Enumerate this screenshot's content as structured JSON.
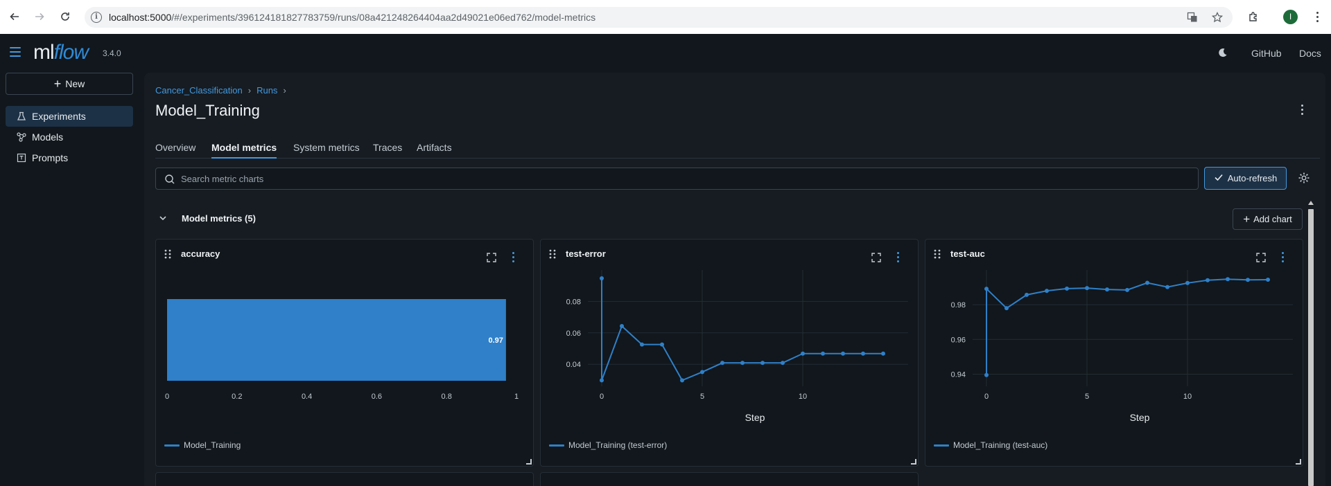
{
  "browser": {
    "url_host": "localhost:5000",
    "url_path": "/#/experiments/396124181827783759/runs/08a421248264404aa2d49021e06ed762/model-metrics",
    "profile_initial": "I"
  },
  "header": {
    "logo_ml": "ml",
    "logo_flow": "flow",
    "version": "3.4.0",
    "links": [
      "GitHub",
      "Docs"
    ]
  },
  "sidebar": {
    "new_label": "New",
    "items": [
      {
        "label": "Experiments",
        "icon": "beaker-icon",
        "active": true
      },
      {
        "label": "Models",
        "icon": "models-icon",
        "active": false
      },
      {
        "label": "Prompts",
        "icon": "prompt-icon",
        "active": false
      }
    ]
  },
  "breadcrumb": [
    "Cancer_Classification",
    "Runs"
  ],
  "page_title": "Model_Training",
  "tabs": [
    "Overview",
    "Model metrics",
    "System metrics",
    "Traces",
    "Artifacts"
  ],
  "active_tab": "Model metrics",
  "search": {
    "placeholder": "Search metric charts",
    "value": ""
  },
  "auto_refresh_label": "Auto-refresh",
  "section": {
    "title": "Model metrics (5)",
    "add_chart_label": "Add chart"
  },
  "colors": {
    "accent": "#4299e0",
    "series": "#2f80c9",
    "background": "#11171c"
  },
  "charts": [
    {
      "title": "accuracy",
      "legend": "Model_Training",
      "chart_data": {
        "type": "bar",
        "orientation": "horizontal",
        "categories": [
          "Model_Training"
        ],
        "values": [
          0.97
        ],
        "value_label": "0.97",
        "xlim": [
          0,
          1
        ],
        "xticks": [
          "0",
          "0.2",
          "0.4",
          "0.6",
          "0.8",
          "1"
        ]
      }
    },
    {
      "title": "test-error",
      "legend": "Model_Training (test-error)",
      "chart_data": {
        "type": "line",
        "xlabel": "Step",
        "x": [
          0,
          0,
          1,
          2,
          3,
          4,
          5,
          6,
          7,
          8,
          9,
          10,
          11,
          12,
          13,
          14
        ],
        "y": [
          0.0947,
          0.0298,
          0.0643,
          0.0526,
          0.0526,
          0.0298,
          0.0351,
          0.0409,
          0.0409,
          0.0409,
          0.0409,
          0.0468,
          0.0468,
          0.0468,
          0.0468,
          0.0468
        ],
        "xlim": [
          0,
          14
        ],
        "ylim": [
          0.026,
          0.1
        ],
        "xticks": [
          "0",
          "5",
          "10"
        ],
        "yticks": [
          "0.04",
          "0.06",
          "0.08"
        ]
      }
    },
    {
      "title": "test-auc",
      "legend": "Model_Training (test-auc)",
      "chart_data": {
        "type": "line",
        "xlabel": "Step",
        "x": [
          0,
          0,
          1,
          2,
          3,
          4,
          5,
          6,
          7,
          8,
          9,
          10,
          11,
          12,
          13,
          14
        ],
        "y": [
          0.9395,
          0.9892,
          0.978,
          0.9857,
          0.988,
          0.9893,
          0.9896,
          0.9888,
          0.9885,
          0.9926,
          0.9902,
          0.9925,
          0.9941,
          0.9947,
          0.9943,
          0.9944
        ],
        "xlim": [
          0,
          14
        ],
        "ylim": [
          0.933,
          1.0
        ],
        "xticks": [
          "0",
          "5",
          "10"
        ],
        "yticks": [
          "0.94",
          "0.96",
          "0.98"
        ]
      }
    }
  ]
}
